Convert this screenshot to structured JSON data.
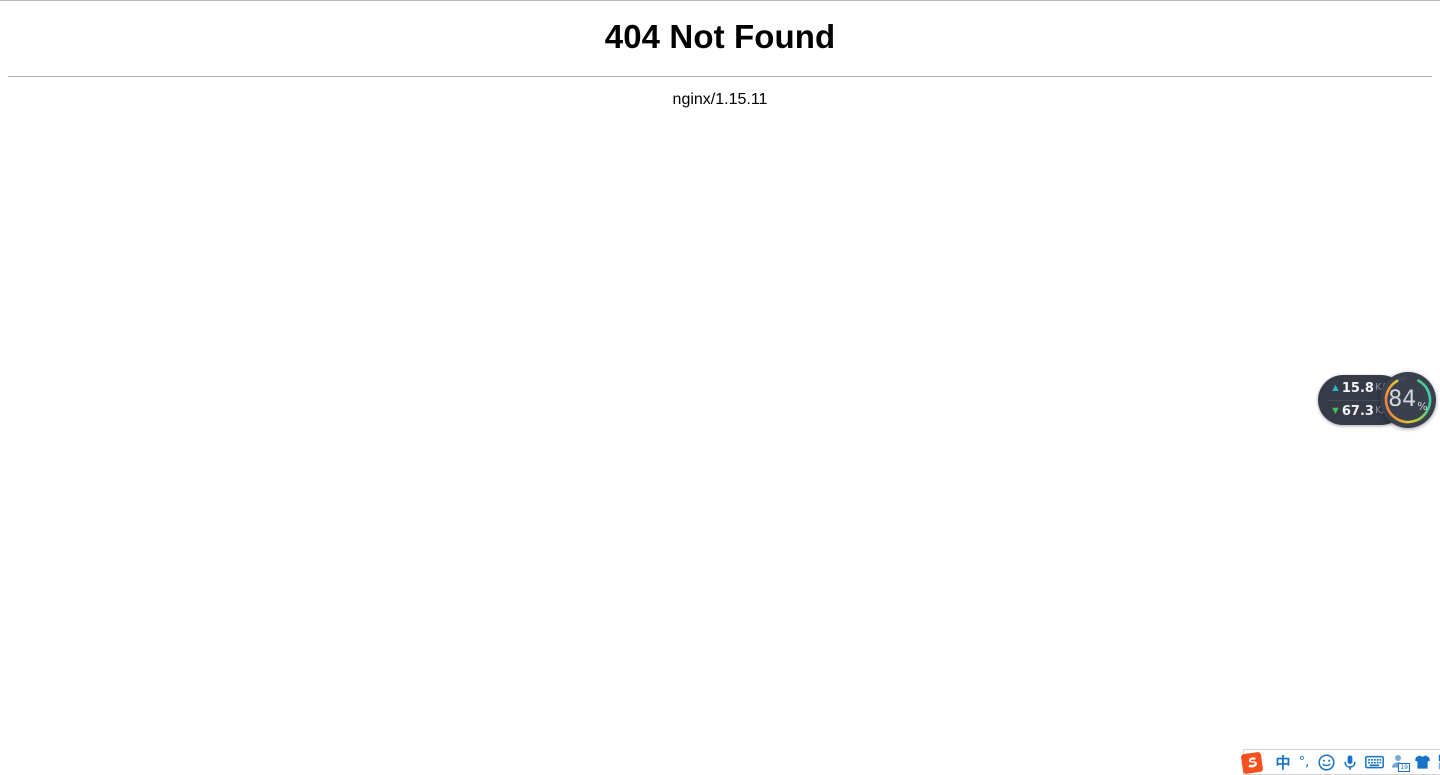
{
  "page": {
    "title": "404 Not Found",
    "server": "nginx/1.15.11"
  },
  "netmon": {
    "upload": {
      "arrow": "up-arrow-icon",
      "value": "15.8",
      "unit": "K/s"
    },
    "download": {
      "arrow": "down-arrow-icon",
      "value": "67.3",
      "unit": "K/s"
    },
    "gauge": {
      "value": "84",
      "percent_symbol": "%",
      "percent": 84
    },
    "colors": {
      "pill_bg": "#363b47",
      "gauge_bg": "#3a404c",
      "upload_arrow": "#2bb7c8",
      "download_arrow": "#3fbf54",
      "value_text": "#f2f4f7",
      "unit_text": "#8a8f9c",
      "gauge_text": "#d2d5db"
    }
  },
  "ime": {
    "logo": "sogou-logo-icon",
    "mode_label": "中",
    "punctuation_label": "°,",
    "items": [
      {
        "name": "emoji-icon"
      },
      {
        "name": "microphone-icon"
      },
      {
        "name": "soft-keyboard-icon"
      },
      {
        "name": "user-center-icon",
        "badge": "19"
      },
      {
        "name": "skin-shirt-icon"
      },
      {
        "name": "toolbox-grid-icon"
      }
    ],
    "colors": {
      "accent": "#1673c8",
      "logo": "#f4511e",
      "panel_bg": "#ffffff",
      "panel_border": "#d2d2d2"
    }
  }
}
